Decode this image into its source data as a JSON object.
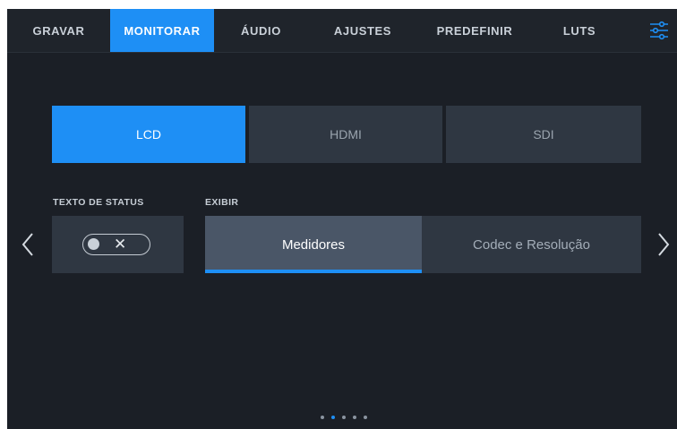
{
  "tabs": [
    {
      "label": "GRAVAR",
      "active": false
    },
    {
      "label": "MONITORAR",
      "active": true
    },
    {
      "label": "ÁUDIO",
      "active": false
    },
    {
      "label": "AJUSTES",
      "active": false
    },
    {
      "label": "PREDEFINIR",
      "active": false
    },
    {
      "label": "LUTS",
      "active": false
    }
  ],
  "menu_icon": "sliders-icon",
  "outputs": {
    "items": [
      {
        "label": "LCD",
        "selected": true
      },
      {
        "label": "HDMI",
        "selected": false
      },
      {
        "label": "SDI",
        "selected": false
      }
    ]
  },
  "status_text": {
    "label": "TEXTO DE STATUS",
    "toggle_on": false,
    "toggle_symbol": "✕"
  },
  "display": {
    "label": "EXIBIR",
    "options": [
      {
        "label": "Medidores",
        "selected": true
      },
      {
        "label": "Codec e Resolução",
        "selected": false
      }
    ]
  },
  "pagination": {
    "pages": 5,
    "current": 2
  },
  "colors": {
    "accent": "#1e8ff5",
    "background": "#1b1f26",
    "panel": "#2f3742",
    "selected_option": "#4a5667"
  }
}
